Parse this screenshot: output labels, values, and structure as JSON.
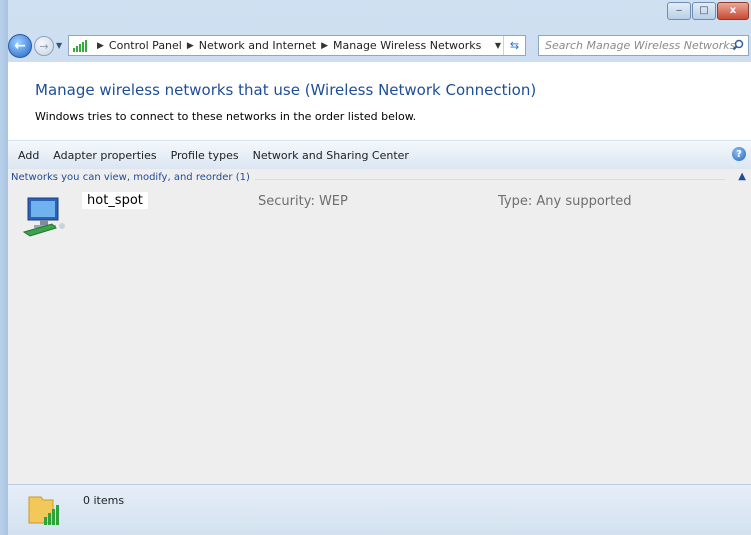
{
  "window": {
    "caption_buttons": {
      "minimize": "‒",
      "maximize": "□",
      "close": "x"
    }
  },
  "nav": {
    "back_glyph": "←",
    "forward_glyph": "→",
    "breadcrumb": [
      "Control Panel",
      "Network and Internet",
      "Manage Wireless Networks"
    ],
    "search_placeholder": "Search Manage Wireless Networks",
    "icons": [
      "back-arrow-icon",
      "forward-arrow-icon",
      "signal-icon",
      "refresh-icon",
      "search-icon"
    ]
  },
  "header": {
    "title": "Manage wireless networks that use (Wireless Network Connection)",
    "subtitle": "Windows tries to connect to these networks in the order listed below."
  },
  "toolbar": {
    "items": [
      "Add",
      "Adapter properties",
      "Profile types",
      "Network and Sharing Center"
    ],
    "help_label": "?"
  },
  "list": {
    "group_header": "Networks you can view, modify, and reorder (1)",
    "networks": [
      {
        "name": "hot_spot",
        "security": "Security: WEP",
        "type": "Type: Any supported"
      }
    ]
  },
  "status": {
    "items_text": "0 items"
  },
  "colors": {
    "title_blue": "#1f4e99",
    "group_blue": "#1e4c9a",
    "list_bg": "#eeeeee",
    "signal_green": "#36a93b"
  }
}
